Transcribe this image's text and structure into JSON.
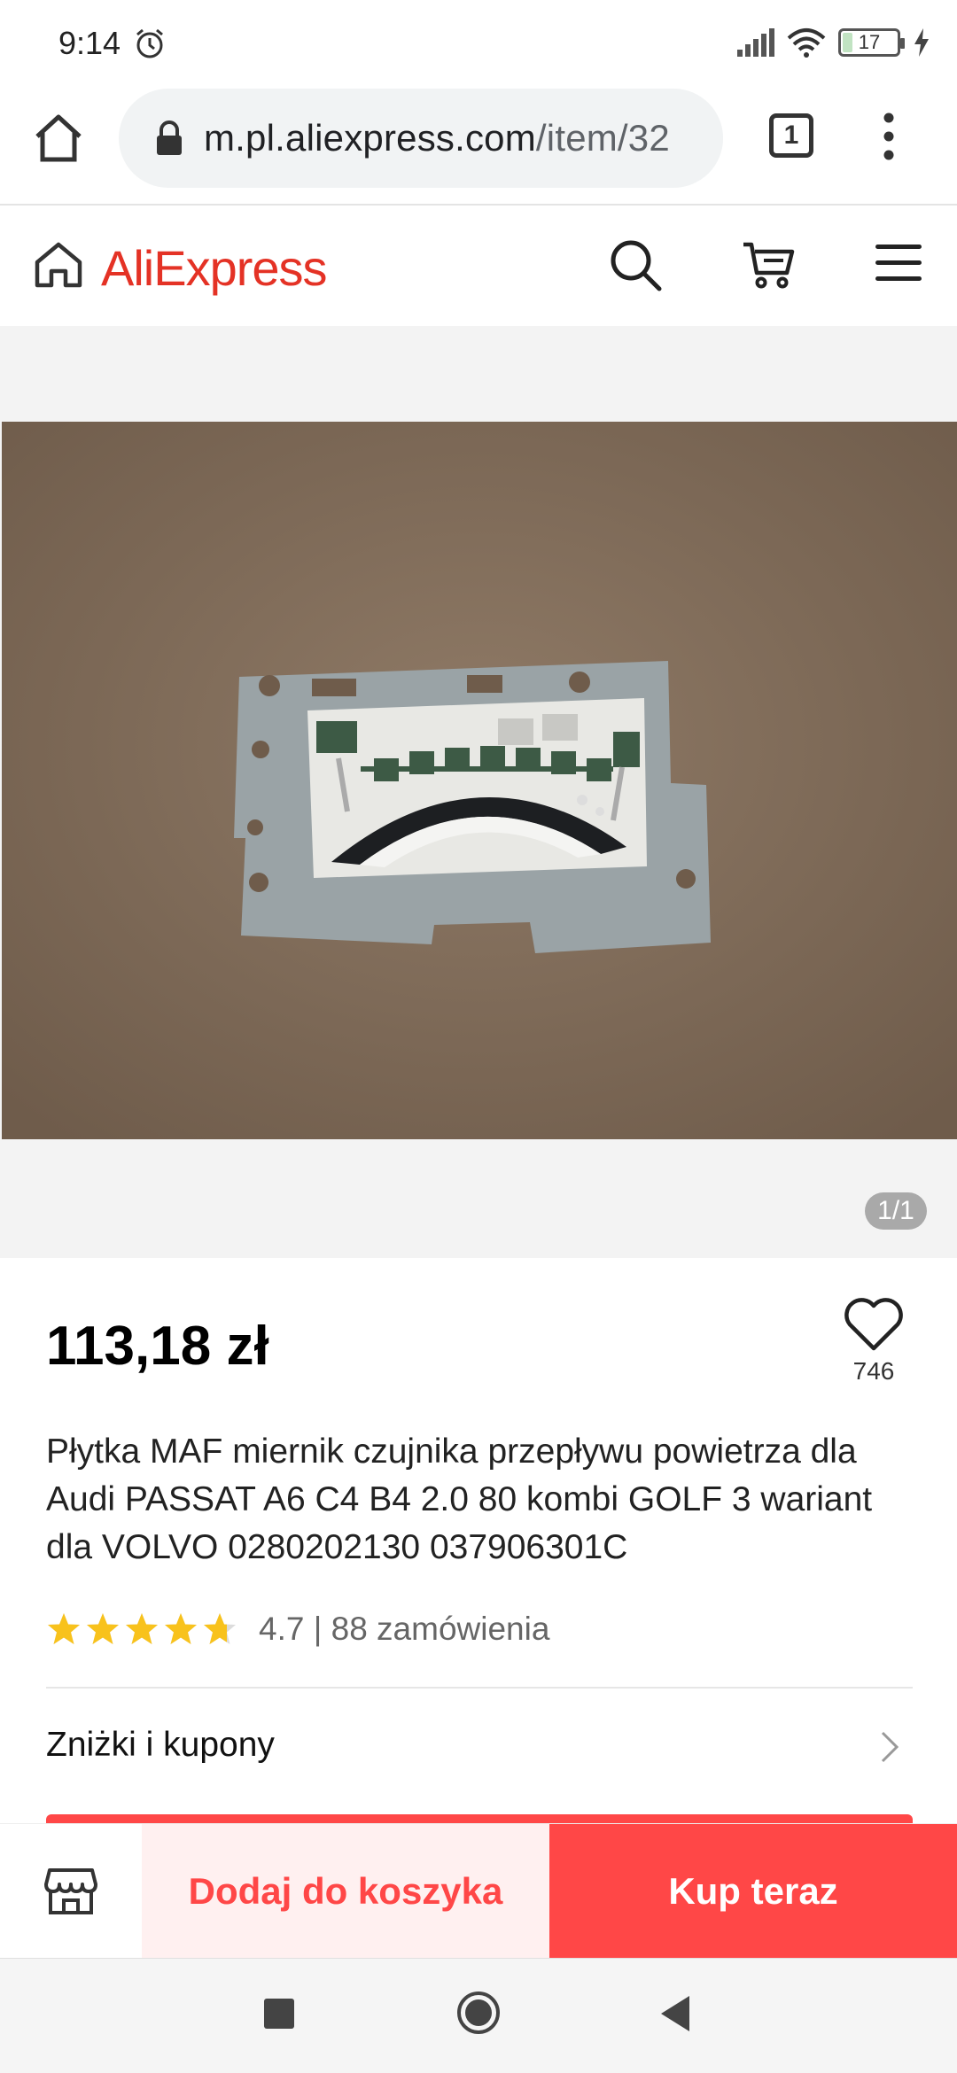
{
  "status_bar": {
    "time": "9:14",
    "battery_level": "17",
    "battery_fraction": 0.17
  },
  "browser": {
    "url_host": "m.pl.aliexpress.com",
    "url_path": "/item/32",
    "tab_count": "1"
  },
  "header": {
    "logo": "AliExpress",
    "brand_color": "#e43225"
  },
  "gallery": {
    "counter": "1/1"
  },
  "product": {
    "price": "113,18 zł",
    "wishlist_count": "746",
    "title": "Płytka MAF miernik czujnika przepływu powietrza dla Audi PASSAT A6 C4 B4 2.0 80 kombi GOLF 3 wariant dla VOLVO 0280202130 037906301C",
    "rating": "4.7",
    "rating_value": 4.7,
    "orders": "88 zamówienia",
    "rating_separator": "|"
  },
  "coupons": {
    "label": "Zniżki i kupony"
  },
  "actions": {
    "add_to_cart": "Dodaj do koszyka",
    "buy_now": "Kup teraz",
    "accent_color": "#ff4747"
  },
  "icons": [
    "home-icon",
    "lock-icon",
    "tabs-icon",
    "more-icon",
    "search-icon",
    "cart-icon",
    "menu-icon",
    "heart-icon",
    "star-icon",
    "chevron-right-icon",
    "store-icon"
  ]
}
